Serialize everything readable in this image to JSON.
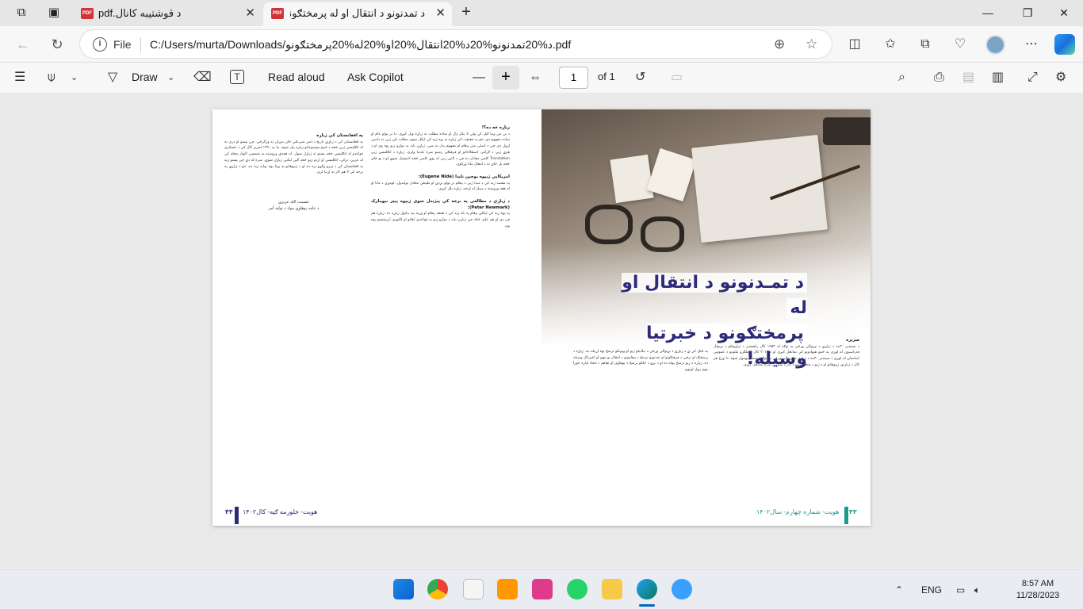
{
  "browser": {
    "tabs": [
      {
        "label": "د قوشتیبه کانال.pdf",
        "icon": "pdf-icon",
        "active": false
      },
      {
        "label": "د تمدنونو د انتقال او له پرمختګونو.f",
        "icon": "pdf-icon",
        "active": true
      }
    ],
    "address": {
      "scheme_label": "File",
      "url": "C:/Users/murta/Downloads/د%20تمدنونو%20د%20انتقال%20او%20له%20پرمختګونو.pdf"
    }
  },
  "pdf_toolbar": {
    "draw_label": "Draw",
    "read_aloud_label": "Read aloud",
    "ask_copilot_label": "Ask Copilot",
    "page_number": "1",
    "page_of": "of 1"
  },
  "document": {
    "title_line1": "د تمـدنونو د انتقال او له",
    "title_line2": "پرمختګونو د خبرتیا وسیله!",
    "left_col1_heading": "زباړه څه ده؟!",
    "left_col1_text": "د بې من وينا ګڼل کې ولې لا يکل ډک او ساده مطلب ته ژباړه ويل کيږي. دا تر ټولو عام او ساده مفهوم دی، خو په حقيقت کې ژباړه په يوه ژبه کې ليکل شوي مطلب بلې ژبې ته داسې اړول دي چې د اصلي متن پيغام او مفهوم بدل نه شي. ژباړن بايد په دواړو ژبو پوه وي او د هرې ژبې د ګرامر، اصطلاحاتو او فرهنګي زمينو سره بلدتيا ولري. ژباړه د انګليسي ژبې Translation کلمې معادل ده چې د لاتين ژبې له يوې کلمې څخه اخيستل شوې او د يو ځای څخه بل ځای ته د انتقال مانا ورکوي.",
    "left_col1_heading2": "امريکايي ژبپوه يوجين نايدا (Eugene Nida):",
    "left_col1_text2": "په مقصد ژبه کې د مبدا ژبې د پيغام تر ټولو نږدې او طبيعي معادل توليدول، لومړی د مانا او له هغه وروسته د سبک له اړخه، ژباړه بلل کيږي.",
    "left_col1_heading3": "د ژباړې د مطالعې په برخه کې پيژندل شوی ژبپوه پيټر نيومارک (Peter Newmark):",
    "left_col1_text3": "په يوه ژبه کې ليکلي پيغام په بله ژبه کې د همغه پيغام او ورته بڼه بيانول ژباړه ده. ژباړه هم فن دی او هم علم، ځکه چې ژباړن بايد د دواړو ژبو په قواعدو، لغاتو او کلتوري ارزښتونو پوه وي.",
    "left_col2_heading": "په افغانستان کې ژباړه",
    "left_col2_text": "په افغانستان کې د ژباړې تاريخ د امير شيرعلي خان دوران ته ورګرځي، چې پښتو او دري ته له انګليسي ژبې څخه د ځينو موضوعاتو ژباړه پيل شوه. بيا په ۱۲۹۰ لمريز کال کې د عسکري قواعدو له انګليسي څخه پښتو ته ژباړل شول. له همدې وروسته په شمسي النهار مجله کې له عربي، ترکي، انګليسي او اردو ژبو څخه ګڼې ليکنې ژباړل شوې. سره له دې چې پښتو ژبه په افغانستان کې د ډېرو وګړو ژبه ده او د ژبپوهانو په وينا يوه بډايه ژبه ده، خو د ژباړې په برخه کې لا هم کار ته اړتيا لري.",
    "signature_name": "عصمت الله عزيزي",
    "signature_role": "د عامه پوهاوي مواد د توليد آمر",
    "right_heading": "سرېزه",
    "right_col1_text": "د سپتمبر ۳۰مه د ژباړې د نړيوالې ورځې په توګه له ۱۹۵۳ کال راهيسې د ژباړونکو د نړيوال فدراسيون له لوري په ځينو هيوادونو کې نمانځل کيږي او د ۲۰۱۷ کال د ملګرو ملتونو د عمومي اسامبلې له لوري د سپتمبر ۳۰مه د ژباړې د نړيوالې ورځې په توګه رسماً ونومول شوه. دا ورځ هر کال د ژباړنو، ژبپوهانو او د ژبو د متخصصينو د کار د ستاينې لپاره نمانځل کيږي.",
    "right_col2_text": "په څنګ کې ې د ژباړې د نړيوالې ورځې د بيلابيلو ژبو او ويونکو ترمنځ يوه اړيکه ده. ژباړه د پرمختګ او ترقۍ، د فرهنګونو او تمدنونو ترمنځ د پيغامونو د انتقال يو مهم او اغيزناک وسيله ده. ژباړه د ژبو ترمنځ پوله ده او د نړۍ د خلکو ترمنځ د پوهاوي او تفاهم د ايجاد لپاره خورا مهم رول لوبوي.",
    "footer_left": "هويت- خلورمه ګڼه- کال۱۴۰۲",
    "page_left": "۴۴",
    "footer_right": "هويت- شماره چهارم- سال۱۴۰۲",
    "page_right": "۴۳",
    "colors": {
      "title": "#2d2a78",
      "footer_left_bar": "#2d2a78",
      "footer_right_bar": "#1a9a8c"
    }
  },
  "taskbar": {
    "apps": [
      "windows-start-icon",
      "chrome-icon",
      "calendar-app-icon",
      "sublime-icon",
      "wps-icon",
      "whatsapp-icon",
      "file-explorer-icon",
      "edge-icon",
      "paint-icon"
    ],
    "language": "ENG",
    "time": "8:57 AM",
    "date": "11/28/2023"
  }
}
